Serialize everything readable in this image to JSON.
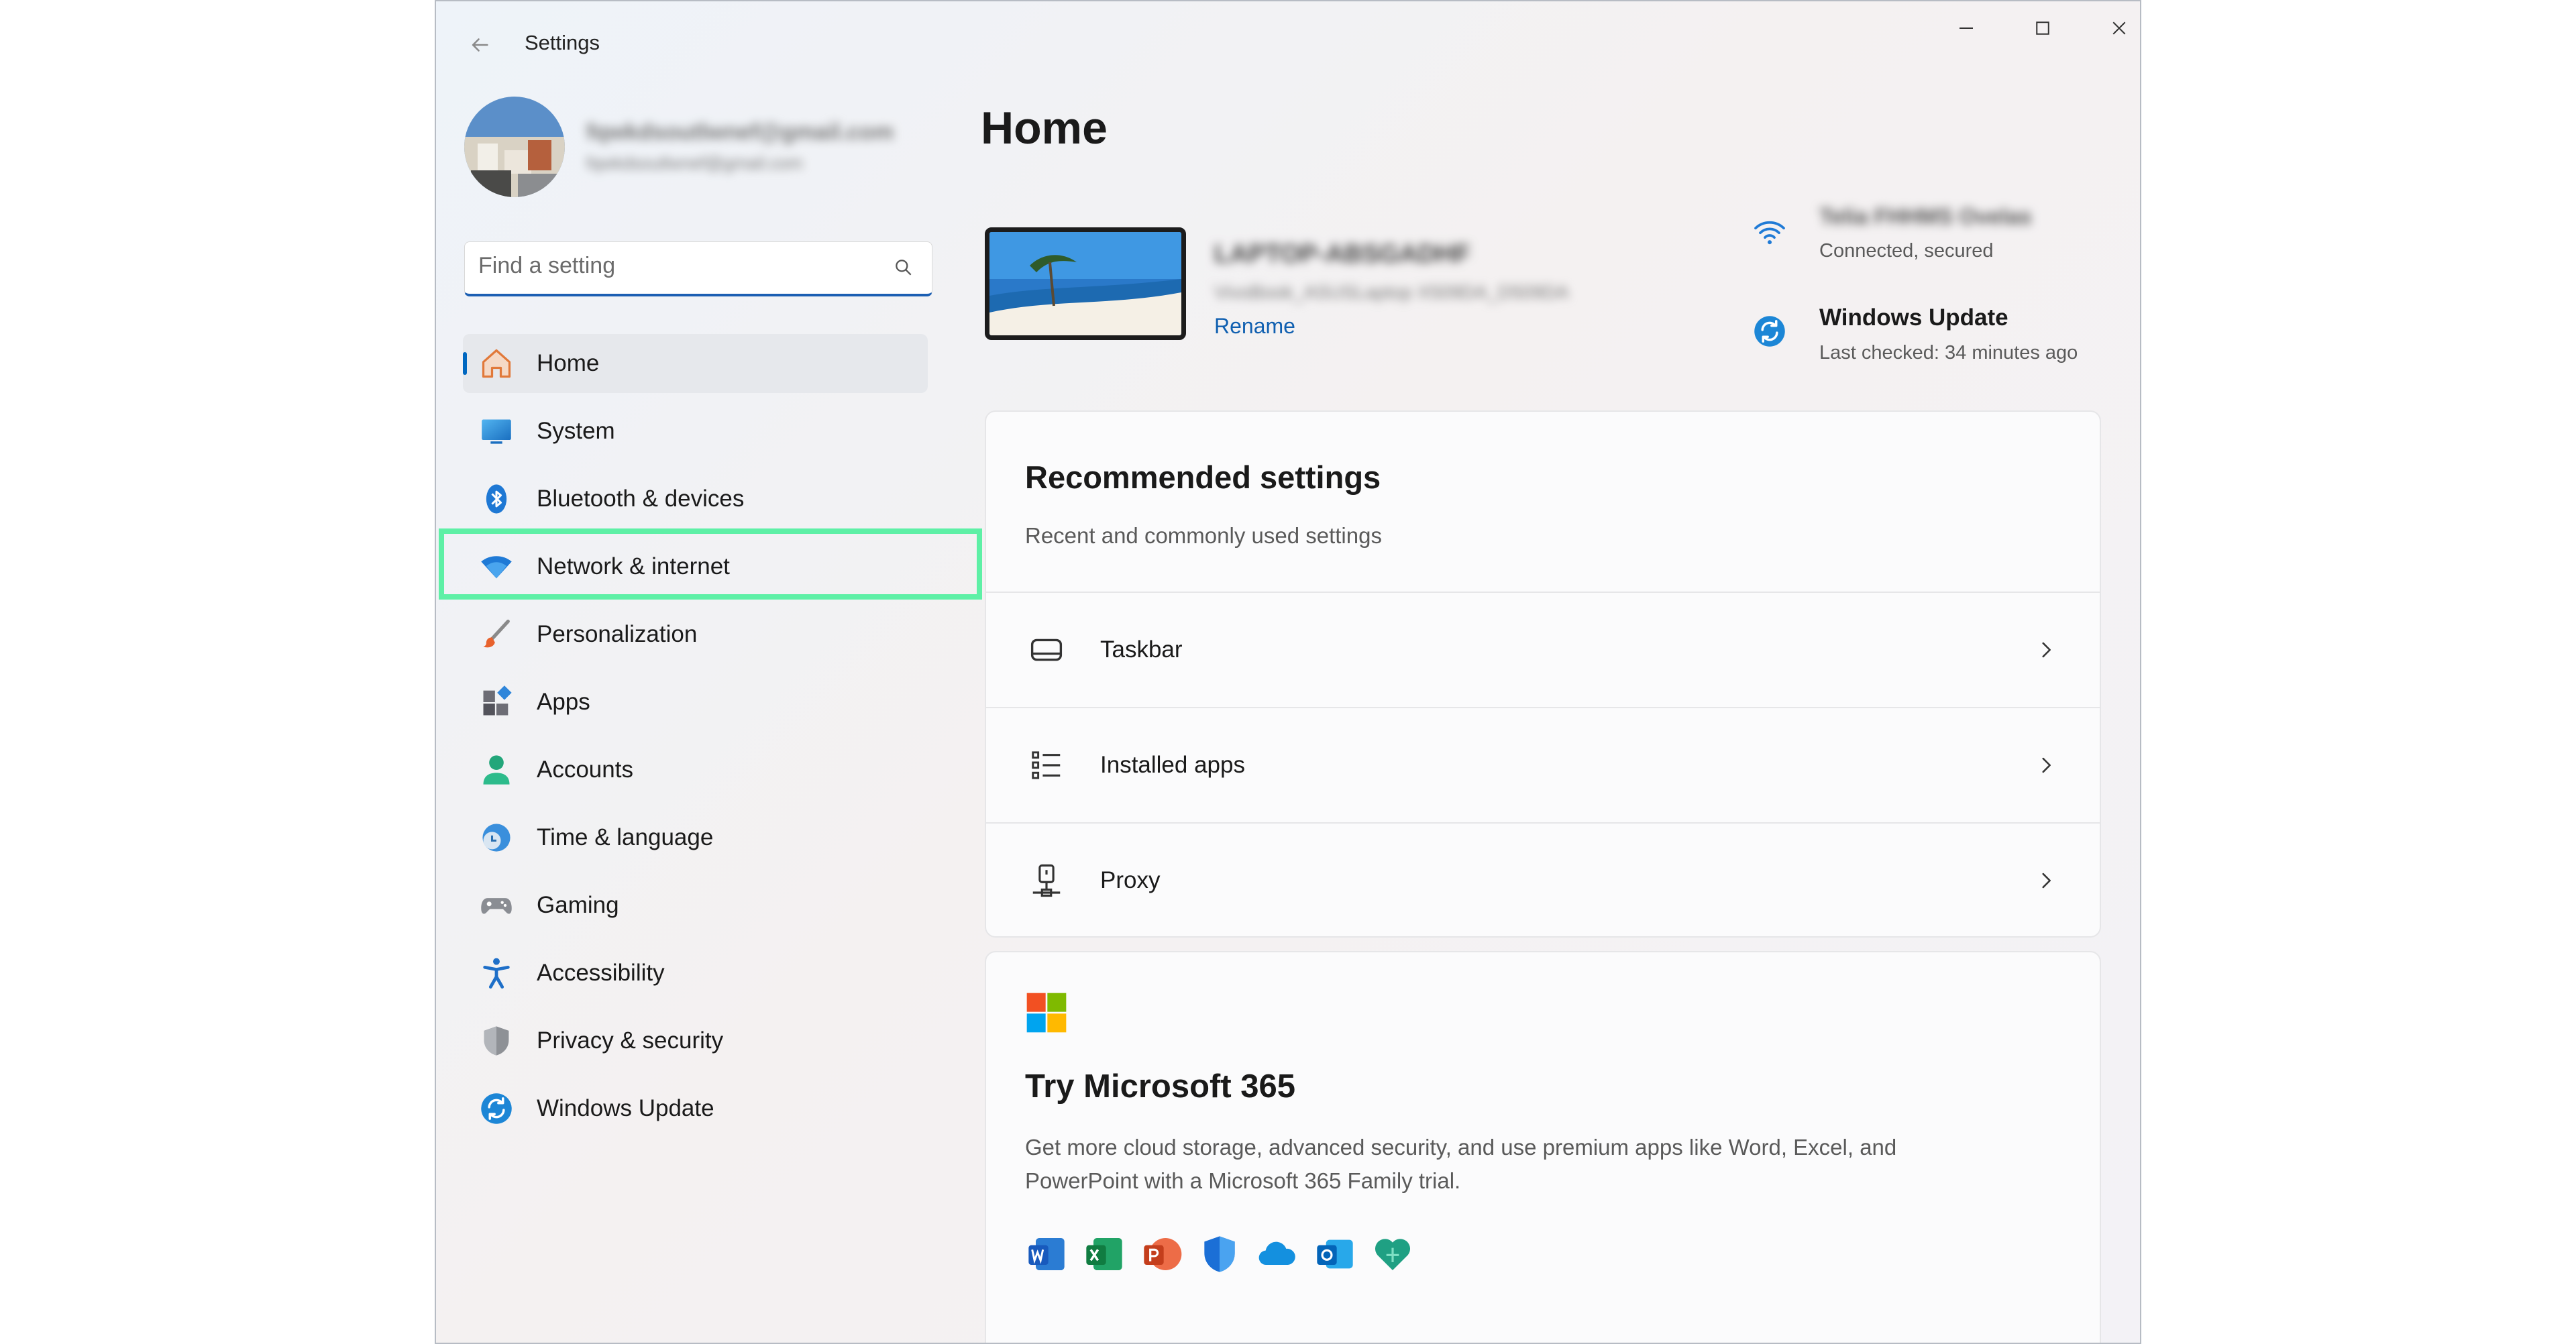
{
  "window": {
    "title": "Settings",
    "controls": {
      "minimize": "minimize-icon",
      "maximize": "maximize-icon",
      "close": "close-icon"
    }
  },
  "user": {
    "name": "fqwkdsoutlwnef@gmail.com",
    "email": "fqwkdsoutlwnef@gmail.com"
  },
  "search": {
    "placeholder": "Find a setting"
  },
  "sidebar": {
    "items": [
      {
        "label": "Home",
        "icon": "home-icon",
        "selected": true
      },
      {
        "label": "System",
        "icon": "system-icon"
      },
      {
        "label": "Bluetooth & devices",
        "icon": "bluetooth-icon"
      },
      {
        "label": "Network & internet",
        "icon": "wifi-icon",
        "highlighted": true
      },
      {
        "label": "Personalization",
        "icon": "brush-icon"
      },
      {
        "label": "Apps",
        "icon": "apps-icon"
      },
      {
        "label": "Accounts",
        "icon": "accounts-icon"
      },
      {
        "label": "Time & language",
        "icon": "clock-icon"
      },
      {
        "label": "Gaming",
        "icon": "gamepad-icon"
      },
      {
        "label": "Accessibility",
        "icon": "accessibility-icon"
      },
      {
        "label": "Privacy & security",
        "icon": "shield-icon"
      },
      {
        "label": "Windows Update",
        "icon": "update-icon"
      }
    ]
  },
  "main": {
    "title": "Home",
    "device": {
      "name": "LAPTOP-ABSGADHF",
      "model": "VivoBook_ASUSLaptop X509DA_D509DA",
      "rename_label": "Rename"
    },
    "status": {
      "wifi": {
        "network": "Telia FHHMS Ovelas",
        "state": "Connected, secured"
      },
      "update": {
        "title": "Windows Update",
        "detail": "Last checked: 34 minutes ago"
      }
    },
    "recommended": {
      "title": "Recommended settings",
      "subtitle": "Recent and commonly used settings",
      "items": [
        {
          "label": "Taskbar",
          "icon": "taskbar-icon"
        },
        {
          "label": "Installed apps",
          "icon": "list-icon"
        },
        {
          "label": "Proxy",
          "icon": "proxy-icon"
        }
      ]
    },
    "m365": {
      "title": "Try Microsoft 365",
      "description_line1": "Get more cloud storage, advanced security, and use premium apps like Word, Excel, and",
      "description_line2": "PowerPoint with a Microsoft 365 Family trial.",
      "apps": [
        "word-icon",
        "excel-icon",
        "powerpoint-icon",
        "defender-icon",
        "onedrive-icon",
        "outlook-icon",
        "family-icon"
      ]
    }
  },
  "colors": {
    "accent": "#0067c0",
    "highlight": "#5ef0a6",
    "sidebar_selected": "#e6e8ec"
  }
}
